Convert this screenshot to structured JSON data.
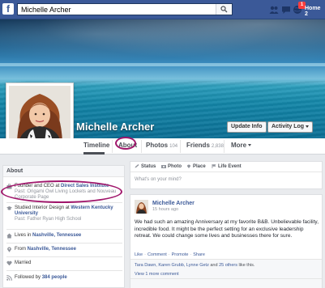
{
  "topbar": {
    "logo": "f",
    "search_value": "Michelle Archer",
    "notification_count": "1",
    "home_label": "Home",
    "home_suffix": "2"
  },
  "profile": {
    "name": "Michelle Archer",
    "update_info_label": "Update Info",
    "activity_log_label": "Activity Log"
  },
  "tabs": [
    {
      "label": "Timeline",
      "count": ""
    },
    {
      "label": "About",
      "count": ""
    },
    {
      "label": "Photos",
      "count": "104"
    },
    {
      "label": "Friends",
      "count": "2,838"
    },
    {
      "label": "More",
      "count": ""
    }
  ],
  "about": {
    "heading": "About",
    "items": [
      {
        "icon": "briefcase-icon",
        "prefix": "Founder and CEO at ",
        "link": "Direct Sales Institute",
        "sub": "Past: Origami Owl Living Lockets and Nouveau Corporate Page"
      },
      {
        "icon": "graduation-cap-icon",
        "prefix": "Studied Interior Design at ",
        "link": "Western Kentucky University",
        "sub": "Past: Father Ryan High School"
      },
      {
        "icon": "home-icon",
        "prefix": "Lives in ",
        "link": "Nashville, Tennessee",
        "sub": ""
      },
      {
        "icon": "location-pin-icon",
        "prefix": "From ",
        "link": "Nashville, Tennessee",
        "sub": ""
      },
      {
        "icon": "heart-icon",
        "prefix": "Married",
        "link": "",
        "sub": ""
      },
      {
        "icon": "rss-icon",
        "prefix": "Followed by ",
        "link": "384 people",
        "sub": ""
      }
    ]
  },
  "composer": {
    "tabs": [
      "Status",
      "Photo",
      "Place",
      "Life Event"
    ],
    "placeholder": "What's on your mind?"
  },
  "post": {
    "author": "Michelle Archer",
    "time": "15 hours ago",
    "body": "We had such an amazing Anniversary at my favorite B&B. Unbelievable facility, incredible food. It might be the perfect setting for an exclusive leadership retreat. We could change some lives and businesses there for sure.",
    "actions": [
      "Like",
      "Comment",
      "Promote",
      "Share"
    ],
    "likes_names": "Tara Dawn, Karen Grubb, Lynne Getz",
    "likes_and": " and ",
    "likes_others": "25 others",
    "likes_suffix": " like this.",
    "view_more": "View 1 more comment"
  },
  "colors": {
    "brand": "#3b5998",
    "highlight_circle": "#a0166b",
    "notification": "#fa3e3e"
  }
}
